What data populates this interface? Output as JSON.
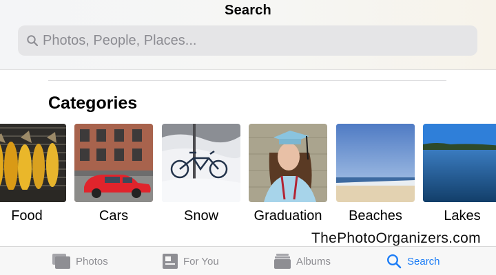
{
  "header": {
    "title": "Search",
    "search_placeholder": "Photos, People, Places..."
  },
  "section": {
    "title": "Categories"
  },
  "categories": [
    {
      "label": "Food",
      "icon": "food-thumbnail"
    },
    {
      "label": "Cars",
      "icon": "cars-thumbnail"
    },
    {
      "label": "Snow",
      "icon": "snow-thumbnail"
    },
    {
      "label": "Graduation",
      "icon": "graduation-thumbnail"
    },
    {
      "label": "Beaches",
      "icon": "beaches-thumbnail"
    },
    {
      "label": "Lakes",
      "icon": "lakes-thumbnail"
    }
  ],
  "watermark": "ThePhotoOrganizers.com",
  "tabbar": {
    "tabs": [
      {
        "label": "Photos",
        "icon": "photos-icon",
        "active": false
      },
      {
        "label": "For You",
        "icon": "for-you-icon",
        "active": false
      },
      {
        "label": "Albums",
        "icon": "albums-icon",
        "active": false
      },
      {
        "label": "Search",
        "icon": "search-icon",
        "active": true
      }
    ]
  },
  "colors": {
    "accent": "#1b7cf6",
    "inactive": "#8e8e93",
    "search_field": "#e5e5e7"
  }
}
